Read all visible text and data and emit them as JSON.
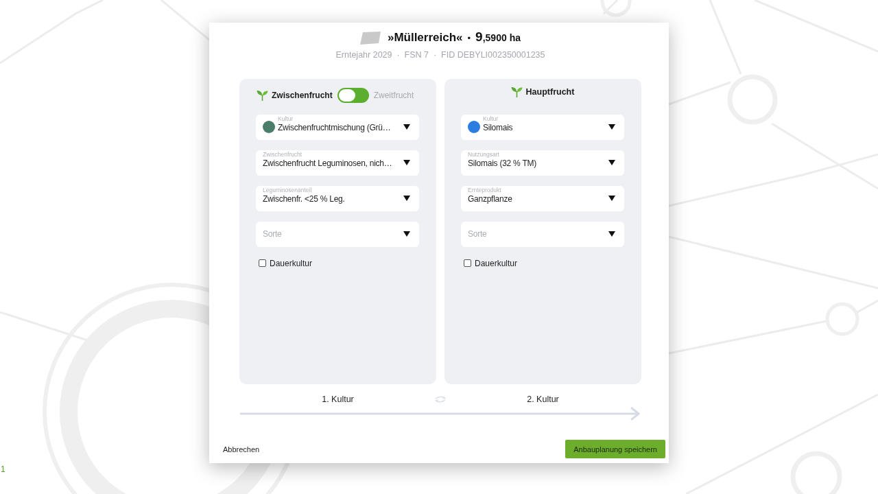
{
  "slide_number": "1",
  "dialog": {
    "header": {
      "field_name": "»Müllerreich«",
      "separator": "•",
      "area_whole": "9",
      "area_fraction": ",5900",
      "area_unit": "ha",
      "subtitle": "Erntejahr 2029  ·  FSN 7  ·  FID DEBYLI002350001235"
    },
    "panels": [
      {
        "kind": "toggle",
        "options": [
          {
            "label": "Zwischenfrucht",
            "selected": true
          },
          {
            "label": "Zweitfrucht",
            "selected": false
          }
        ],
        "fields": [
          {
            "kind": "culture",
            "label": "Kultur",
            "value": "Zwischenfruchtmischung (Grü…",
            "color": "#4b7d6b"
          },
          {
            "kind": "select",
            "label": "Zwischenfrucht",
            "value": "Zwischenfrucht Leguminosen, nich…"
          },
          {
            "kind": "select",
            "label": "Leguminosenanteil",
            "value": "Zwischenfr. <25 % Leg."
          },
          {
            "kind": "select",
            "placeholder": "Sorte"
          }
        ],
        "checkbox": {
          "label": "Dauerkultur",
          "checked": false
        },
        "caption": "1. Kultur"
      },
      {
        "kind": "title",
        "title": "Hauptfrucht",
        "fields": [
          {
            "kind": "culture",
            "label": "Kultur",
            "value": "Silomais",
            "color": "#2a7de1"
          },
          {
            "kind": "select",
            "label": "Nutzungsart",
            "value": "Silomais (32 % TM)"
          },
          {
            "kind": "select",
            "label": "Ernteprodukt",
            "value": "Ganzpflanze"
          },
          {
            "kind": "select",
            "placeholder": "Sorte"
          }
        ],
        "checkbox": {
          "label": "Dauerkultur",
          "checked": false
        },
        "caption": "2. Kultur"
      }
    ],
    "buttons": {
      "cancel": "Abbrechen",
      "save": "Anbauplanung speichern"
    }
  }
}
